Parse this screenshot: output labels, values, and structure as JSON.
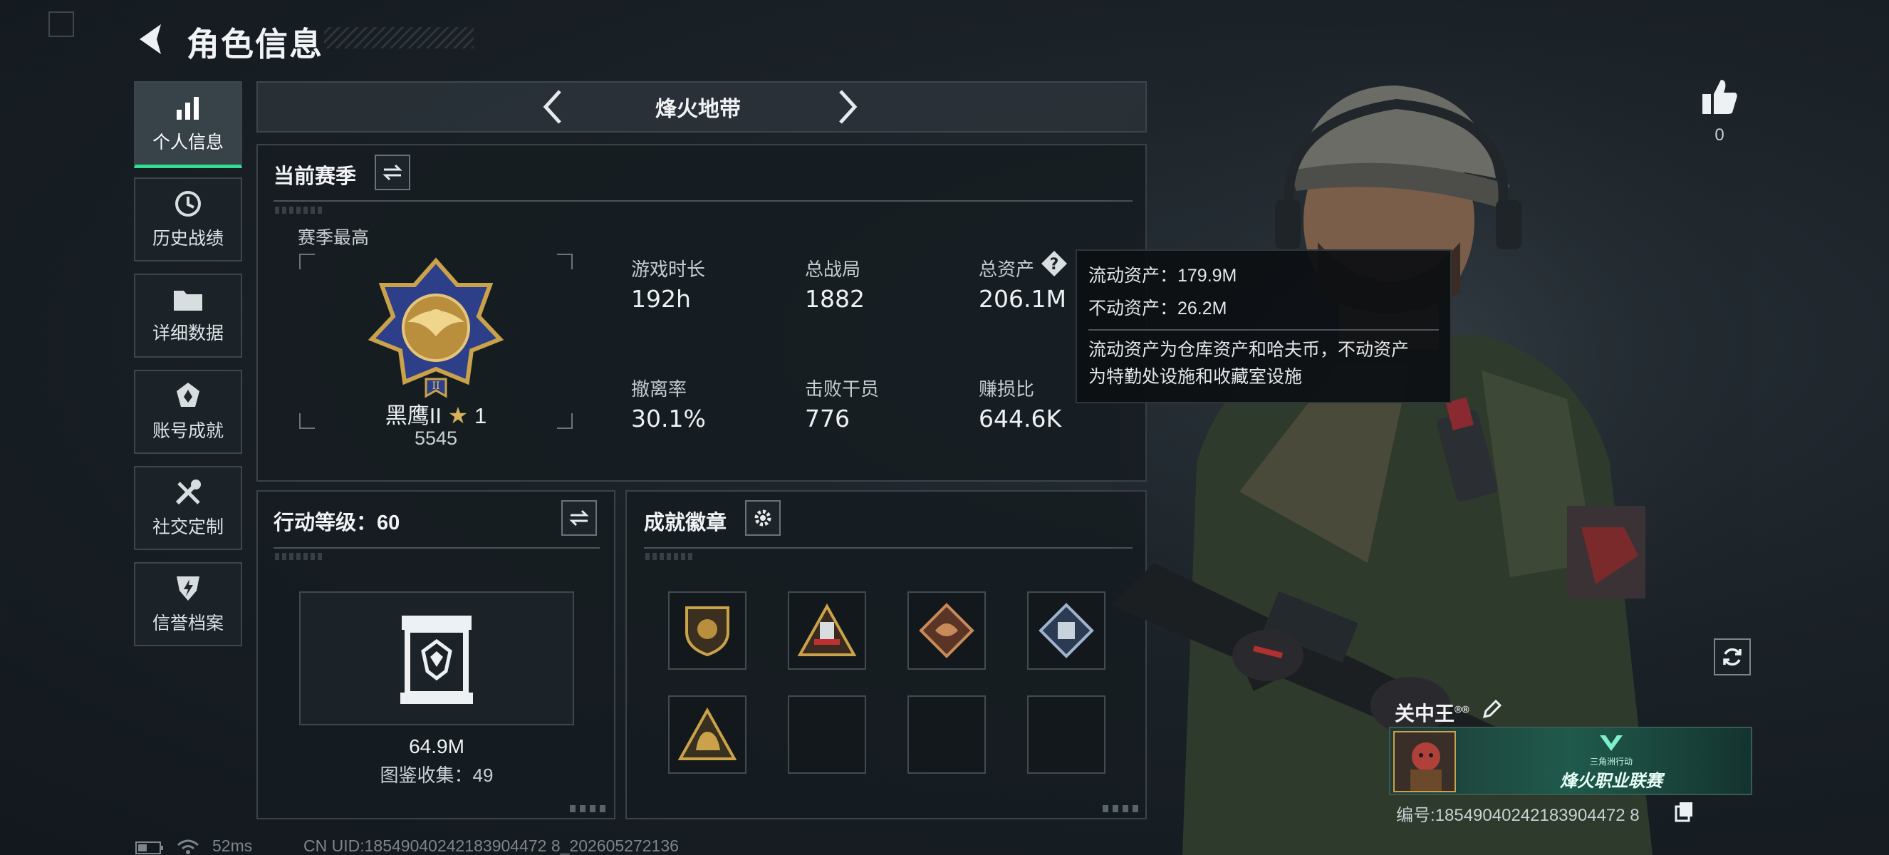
{
  "header": {
    "title": "角色信息"
  },
  "sidebar": {
    "items": [
      {
        "label": "个人信息",
        "icon": "bar-chart-icon",
        "active": true
      },
      {
        "label": "历史战绩",
        "icon": "history-icon"
      },
      {
        "label": "详细数据",
        "icon": "folder-icon"
      },
      {
        "label": "账号成就",
        "icon": "achievement-icon"
      },
      {
        "label": "社交定制",
        "icon": "tools-icon"
      },
      {
        "label": "信誉档案",
        "icon": "shield-icon"
      }
    ]
  },
  "mode_selector": {
    "label": "烽火地带"
  },
  "season": {
    "title": "当前赛季",
    "best_label": "赛季最高",
    "rank_name": "黑鹰II",
    "rank_stars": "1",
    "rank_points": "5545",
    "stats": [
      {
        "label": "游戏时长",
        "value": "192h"
      },
      {
        "label": "总战局",
        "value": "1882"
      },
      {
        "label": "总资产",
        "value": "206.1M"
      },
      {
        "label": "撤离率",
        "value": "30.1%"
      },
      {
        "label": "击败干员",
        "value": "776"
      },
      {
        "label": "赚损比",
        "value": "644.6K"
      }
    ]
  },
  "tooltip": {
    "line1": "流动资产：179.9M",
    "line2": "不动资产：26.2M",
    "desc1": "流动资产为仓库资产和哈夫币，不动资产",
    "desc2": "为特勤处设施和收藏室设施"
  },
  "level": {
    "title": "行动等级：60",
    "value": "64.9M",
    "collection": "图鉴收集：49"
  },
  "badges": {
    "title": "成就徽章",
    "items": [
      "lion-shield-badge",
      "tower-triangle-badge",
      "dragon-diamond-badge",
      "crate-diamond-badge",
      "elephant-triangle-badge",
      "",
      "",
      ""
    ]
  },
  "player": {
    "likes": "0",
    "name": "关中王",
    "name_suffix": "®®",
    "card_text": "烽火职业联赛",
    "card_sub": "三角洲行动",
    "id_text": "编号:18549040242183904472 8"
  },
  "status": {
    "ping": "52ms",
    "uid": "CN UID:18549040242183904472 8_202605272136"
  },
  "colors": {
    "accent": "#30e08e",
    "gold": "#c9a24a",
    "panel": "#161c21"
  }
}
